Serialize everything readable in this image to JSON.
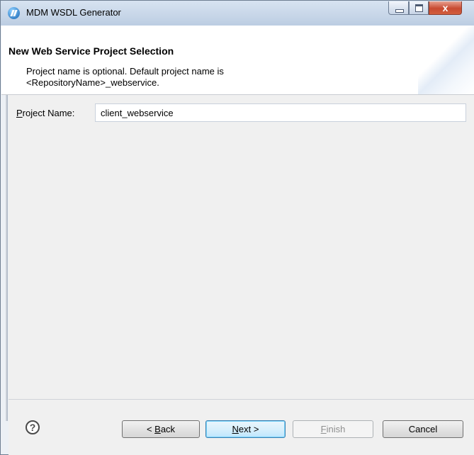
{
  "window": {
    "title": "MDM WSDL Generator",
    "controls": {
      "minimize": "",
      "maximize": "",
      "close": "x"
    }
  },
  "header": {
    "title": "New Web Service Project Selection",
    "description_line1": "Project name is optional. Default project name is",
    "description_line2": "<RepositoryName>_webservice."
  },
  "form": {
    "project_name_label_mnemonic": "P",
    "project_name_label_rest": "roject Name:",
    "project_name_value": "client_webservice"
  },
  "footer": {
    "help": "?",
    "back_prefix": "< ",
    "back_mnemonic": "B",
    "back_rest": "ack",
    "next_mnemonic": "N",
    "next_rest": "ext >",
    "finish_mnemonic": "F",
    "finish_rest": "inish",
    "cancel": "Cancel"
  },
  "colors": {
    "next_button_border": "#3c7fb1",
    "close_button": "#c84a31"
  }
}
